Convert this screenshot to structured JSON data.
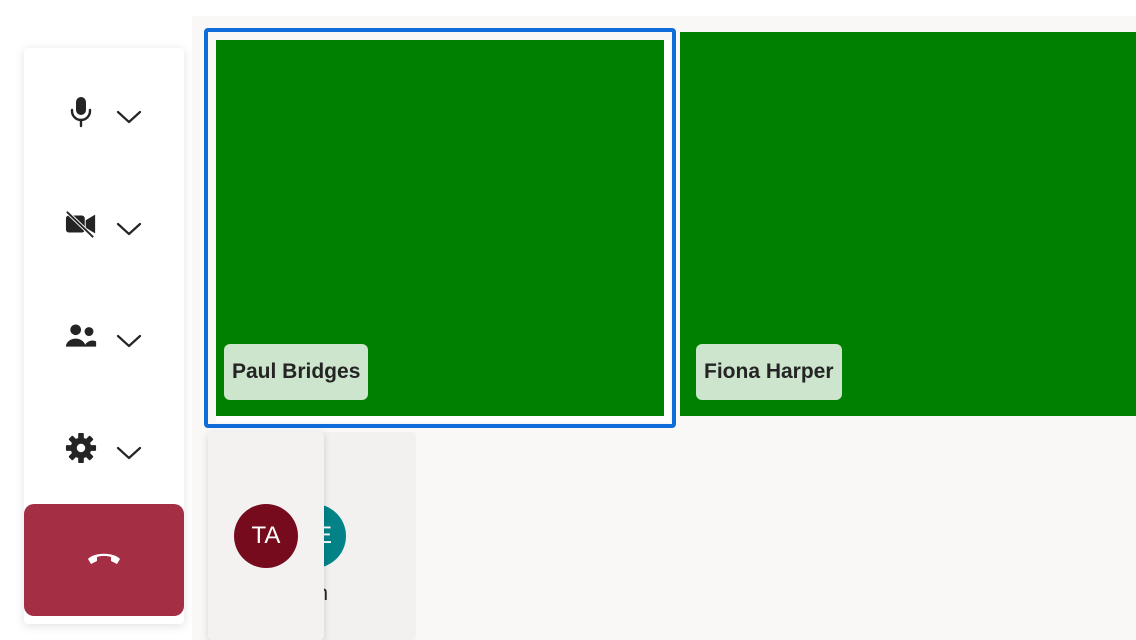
{
  "controls": {
    "microphone": {
      "icon": "microphone-icon"
    },
    "camera": {
      "icon": "camera-off-icon"
    },
    "people": {
      "icon": "people-icon"
    },
    "settings": {
      "icon": "gear-icon"
    },
    "end_call": {
      "icon": "hang-up-icon"
    }
  },
  "stage": {
    "tiles": [
      {
        "name": "Paul Bridges",
        "selected": true,
        "color": "#008000"
      },
      {
        "name": "Fiona Harper",
        "selected": false,
        "color": "#008000"
      }
    ],
    "cards": [
      {
        "initials": "E",
        "label": "ein",
        "avatar_color": "#038387"
      },
      {
        "initials": "TA",
        "avatar_color": "#750b1c"
      }
    ]
  },
  "colors": {
    "selection_border": "#0f6cd8",
    "end_call": "#a42e43",
    "name_tag_bg": "#cce5cc"
  }
}
